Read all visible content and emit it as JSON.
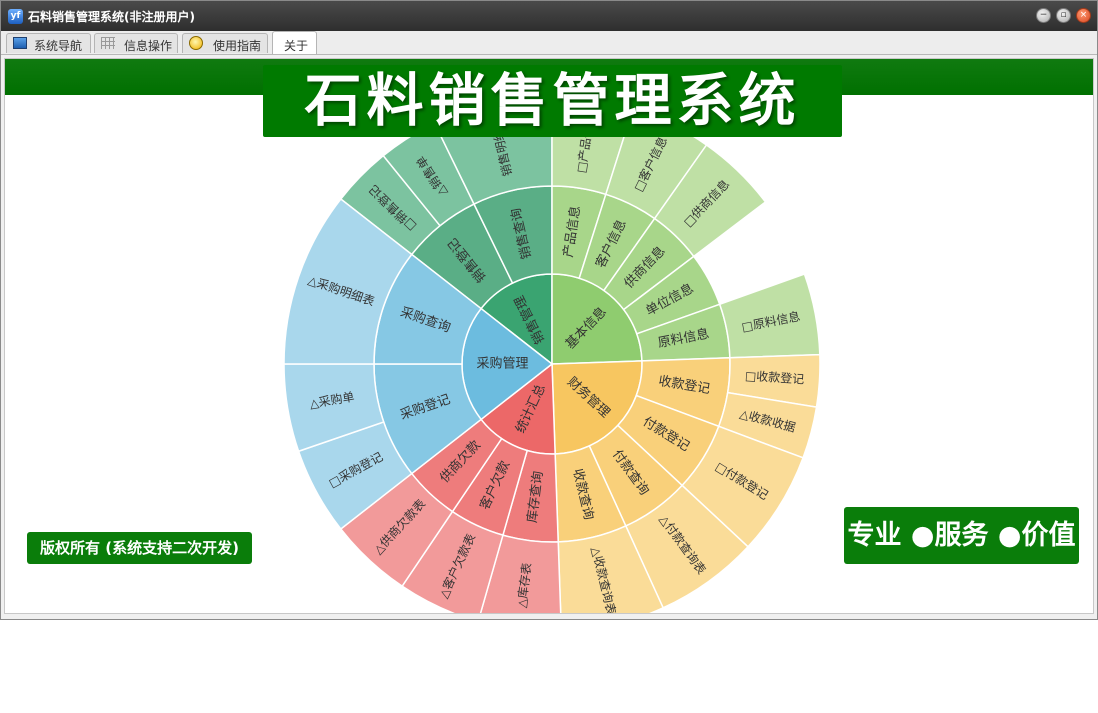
{
  "window": {
    "title": "石料销售管理系统(非注册用户)",
    "app_icon": "yf"
  },
  "window_controls": {
    "minimize_glyph": "−",
    "maximize_glyph": "▫",
    "close_glyph": "×"
  },
  "tabs": [
    {
      "label": "系统导航",
      "icon": "monitor-icon"
    },
    {
      "label": "信息操作",
      "icon": "grid-icon"
    },
    {
      "label": "使用指南",
      "icon": "lightbulb-icon"
    },
    {
      "label": "关于",
      "icon": ""
    }
  ],
  "header": {
    "title": "石料销售管理系统"
  },
  "footer": {
    "copyright": "版权所有 (系统支持二次开发)",
    "slogan": "专业 ●服务 ●价值"
  },
  "colors": {
    "title_bar": "#3a3a3a",
    "accent_green": "#007a00",
    "sales": "#3aa471",
    "basic": "#8fcc6f",
    "finance": "#f7c660",
    "stats": "#ec6868",
    "purchase": "#6cbcdf"
  },
  "sunburst": {
    "center_groups": [
      {
        "name": "销售管理",
        "color": "#3aa471",
        "children": [
          {
            "name": "销售登记",
            "children": [
              "□销售登记",
              "△销售单"
            ]
          },
          {
            "name": "销售查询",
            "children": [
              "销售明细表"
            ]
          }
        ]
      },
      {
        "name": "基本信息",
        "color": "#8fcc6f",
        "children": [
          {
            "name": "产品信息",
            "children": [
              "□产品信息"
            ]
          },
          {
            "name": "客户信息",
            "children": [
              "□客户信息"
            ]
          },
          {
            "name": "供商信息",
            "children": [
              "□供商信息"
            ]
          },
          {
            "name": "单位信息",
            "children": []
          },
          {
            "name": "原料信息",
            "children": [
              "□原料信息"
            ]
          }
        ]
      },
      {
        "name": "财务管理",
        "color": "#f7c660",
        "children": [
          {
            "name": "收款登记",
            "children": [
              "□收款登记",
              "△收款收据"
            ]
          },
          {
            "name": "付款登记",
            "children": [
              "□付款登记"
            ]
          },
          {
            "name": "付款查询",
            "children": [
              "△付款查询表"
            ]
          },
          {
            "name": "收款查询",
            "children": [
              "△收款查询表"
            ]
          }
        ]
      },
      {
        "name": "统计汇总",
        "color": "#ec6868",
        "children": [
          {
            "name": "库存查询",
            "children": [
              "△库存表"
            ]
          },
          {
            "name": "客户欠款",
            "children": [
              "△客户欠款表"
            ]
          },
          {
            "name": "供商欠款",
            "children": [
              "△供商欠款表"
            ]
          }
        ]
      },
      {
        "name": "采购管理",
        "color": "#6cbcdf",
        "children": [
          {
            "name": "采购登记",
            "children": [
              "□采购登记",
              "△采购单"
            ]
          },
          {
            "name": "采购查询",
            "children": [
              "△采购明细表"
            ]
          }
        ]
      }
    ]
  }
}
